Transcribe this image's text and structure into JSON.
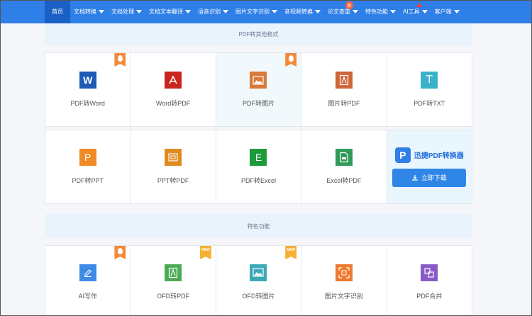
{
  "nav": {
    "items": [
      {
        "label": "首页",
        "active": true,
        "caret": false
      },
      {
        "label": "文档转换",
        "caret": true
      },
      {
        "label": "文档处理",
        "caret": true
      },
      {
        "label": "文档文本翻译",
        "caret": true
      },
      {
        "label": "语音识别",
        "caret": true
      },
      {
        "label": "图片文字识别",
        "caret": true
      },
      {
        "label": "音视频转换",
        "caret": true
      },
      {
        "label": "论文查重",
        "caret": true,
        "badge": "新"
      },
      {
        "label": "特色功能",
        "caret": true
      },
      {
        "label": "AI工具",
        "caret": true,
        "pin": true
      },
      {
        "label": "客户端",
        "caret": true
      }
    ]
  },
  "sections": {
    "pdf_convert": "PDF转其他格式",
    "features": "特色功能"
  },
  "row1": [
    {
      "label": "PDF转Word",
      "icon": "word-icon",
      "glyph": "W",
      "color": "#1e5bb6",
      "tag": "hot"
    },
    {
      "label": "Word转PDF",
      "icon": "pdf-icon",
      "glyph": "A",
      "color": "#c9261f"
    },
    {
      "label": "PDF转图片",
      "icon": "image-icon",
      "glyph": "▣",
      "color": "#d97a3a",
      "tag": "hot",
      "highlight": true
    },
    {
      "label": "图片转PDF",
      "icon": "pdf-icon",
      "glyph": "A",
      "color": "#d0653a"
    },
    {
      "label": "PDF转TXT",
      "icon": "text-icon",
      "glyph": "T",
      "color": "#3ab3c9"
    }
  ],
  "row2": [
    {
      "label": "PDF转PPT",
      "icon": "ppt-icon",
      "glyph": "P",
      "color": "#f08a24"
    },
    {
      "label": "PPT转PDF",
      "icon": "ppt-pdf-icon",
      "glyph": "P",
      "color": "#e08a1f"
    },
    {
      "label": "PDF转Excel",
      "icon": "excel-icon",
      "glyph": "E",
      "color": "#1d9b3a"
    },
    {
      "label": "Excel转PDF",
      "icon": "excel-pdf-icon",
      "glyph": "P",
      "color": "#2f9b57"
    }
  ],
  "promo": {
    "logo_letter": "P",
    "name": "迅捷PDF转换器",
    "button": "立即下载"
  },
  "row3": [
    {
      "label": "AI写作",
      "icon": "pen-icon",
      "glyph": "✎",
      "color": "#3e8be6",
      "tag": "hot"
    },
    {
      "label": "OFD转PDF",
      "icon": "ofd-pdf-icon",
      "glyph": "A",
      "color": "#4bab52",
      "tag": "new"
    },
    {
      "label": "OFD转图片",
      "icon": "ofd-image-icon",
      "glyph": "▣",
      "color": "#3ca8b8",
      "tag": "new"
    },
    {
      "label": "图片文字识别",
      "icon": "ocr-icon",
      "glyph": "⊡",
      "color": "#ef7a2f"
    },
    {
      "label": "PDF合并",
      "icon": "merge-icon",
      "glyph": "⧉",
      "color": "#8a5bc8"
    }
  ],
  "tags": {
    "new": "NEW"
  }
}
